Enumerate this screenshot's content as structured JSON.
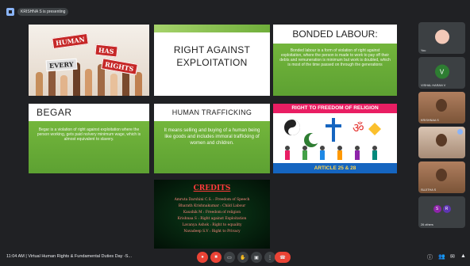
{
  "banner": {
    "text": "KRISHNA S is presenting"
  },
  "slides": {
    "s1": {
      "sign1": "HUMAN",
      "sign2": "HAS",
      "sign3": "EVERY",
      "sign4": "RIGHTS"
    },
    "s2": {
      "line1": "RIGHT AGAINST",
      "line2": "EXPLOITATION"
    },
    "s3": {
      "title": "BONDED LABOUR:",
      "body": "Bonded labour is a form of violation of right against exploitation, where the person is made to work to pay off their debts and remuneration is minimum but work is doubled, which is most of the time passed on through the generations"
    },
    "s4": {
      "title": "BEGAR",
      "body": "Begar is a violation of right against exploitation where the person working, gets paid no/very minimum wage, which is almost equivalent to slavery."
    },
    "s5": {
      "title": "HUMAN TRAFFICKING",
      "body": "It means selling and buying of a human being like goods and includes immoral trafficking of women and children."
    },
    "s6": {
      "title": "RIGHT TO FREEDOM OF RELIGION",
      "article": "ARTICLE 25 & 28"
    },
    "s7": {
      "title": "CREDITS",
      "lines": [
        "Amruta Darshini C.S. : Freedom of Speech",
        "Bharath Krishnakumar : Child Labour",
        "Kaushik M : Freedom of religion",
        "Krishnaa S : Right against Exploitation",
        "Lavanya Ashok : Right to equality",
        "Navadeep S.V : Right to Privacy"
      ]
    }
  },
  "participants": [
    {
      "name": "You"
    },
    {
      "name": "VISHAL HARAN V",
      "initial": "V"
    },
    {
      "name": "KRISHNAA S"
    },
    {
      "name": ""
    },
    {
      "name": "SUJITHA S"
    },
    {
      "name": "26 others",
      "initials": [
        "S",
        "R"
      ]
    }
  ],
  "bottom": {
    "meeting": "11:04 AM  |  Virtual Human Rights & Fundamental Duties Day -S...",
    "controls": [
      "mic-off",
      "cam-off",
      "captions",
      "raise-hand",
      "present",
      "more",
      "leave"
    ]
  },
  "colors": {
    "green": "#6fae3a",
    "leave": "#ea4335",
    "accent": "#8ab4f8"
  }
}
